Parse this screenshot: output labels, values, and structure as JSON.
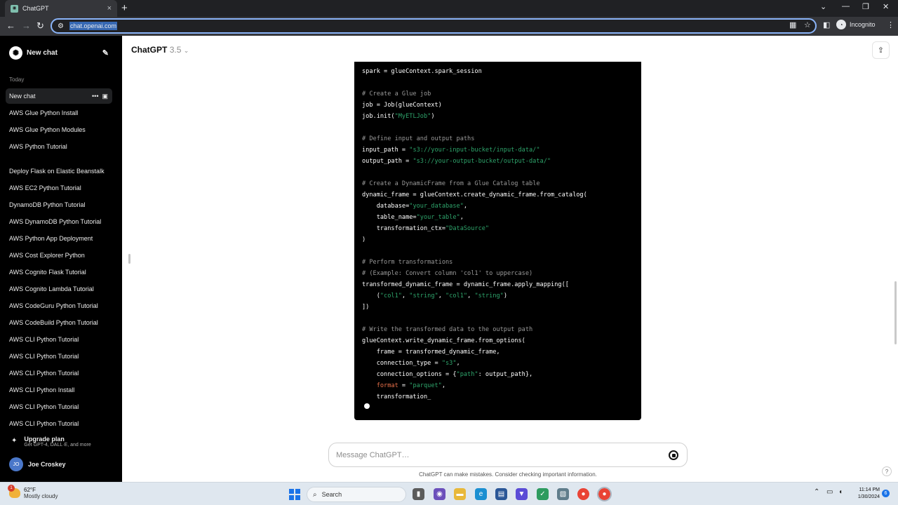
{
  "browser": {
    "tab_title": "ChatGPT",
    "tab_close": "×",
    "new_tab": "+",
    "url": "chat.openai.com",
    "incognito_label": "Incognito"
  },
  "sidebar": {
    "new_chat": "New chat",
    "section_today": "Today",
    "active_item": "New chat",
    "items": [
      "AWS Glue Python Install",
      "AWS Glue Python Modules",
      "AWS Python Tutorial",
      "Deploy Flask on Elastic Beanstalk",
      "AWS EC2 Python Tutorial",
      "DynamoDB Python Tutorial",
      "AWS DynamoDB Python Tutorial",
      "AWS Python App Deployment",
      "AWS Cost Explorer Python",
      "AWS Cognito Flask Tutorial",
      "AWS Cognito Lambda Tutorial",
      "AWS CodeGuru Python Tutorial",
      "AWS CodeBuild Python Tutorial",
      "AWS CLI Python Tutorial",
      "AWS CLI Python Tutorial",
      "AWS CLI Python Tutorial",
      "AWS CLI Python Install",
      "AWS CLI Python Tutorial",
      "AWS CLI Python Tutorial"
    ],
    "upgrade_title": "Upgrade plan",
    "upgrade_sub": "Get GPT-4, DALL·E, and more",
    "user_initials": "JO",
    "user_name": "Joe Croskey"
  },
  "main": {
    "model_name": "ChatGPT",
    "model_version": "3.5",
    "message_placeholder": "Message ChatGPT…",
    "disclaimer": "ChatGPT can make mistakes. Consider checking important information.",
    "help": "?"
  },
  "code_lines": [
    [
      [
        "spark = glueContext.spark_session",
        "t"
      ]
    ],
    [],
    [
      [
        "# Create a Glue job",
        "c"
      ]
    ],
    [
      [
        "job = Job(glueContext)",
        "t"
      ]
    ],
    [
      [
        "job.init(",
        "t"
      ],
      [
        "\"MyETLJob\"",
        "s"
      ],
      [
        ")",
        "t"
      ]
    ],
    [],
    [
      [
        "# Define input and output paths",
        "c"
      ]
    ],
    [
      [
        "input_path = ",
        "t"
      ],
      [
        "\"s3://your-input-bucket/input-data/\"",
        "s"
      ]
    ],
    [
      [
        "output_path = ",
        "t"
      ],
      [
        "\"s3://your-output-bucket/output-data/\"",
        "s"
      ]
    ],
    [],
    [
      [
        "# Create a DynamicFrame from a Glue Catalog table",
        "c"
      ]
    ],
    [
      [
        "dynamic_frame = glueContext.create_dynamic_frame.from_catalog(",
        "t"
      ]
    ],
    [
      [
        "    database=",
        "t"
      ],
      [
        "\"your_database\"",
        "s"
      ],
      [
        ",",
        "t"
      ]
    ],
    [
      [
        "    table_name=",
        "t"
      ],
      [
        "\"your_table\"",
        "s"
      ],
      [
        ",",
        "t"
      ]
    ],
    [
      [
        "    transformation_ctx=",
        "t"
      ],
      [
        "\"DataSource\"",
        "s"
      ]
    ],
    [
      [
        ")",
        "t"
      ]
    ],
    [],
    [
      [
        "# Perform transformations",
        "c"
      ]
    ],
    [
      [
        "# (Example: Convert column 'col1' to uppercase)",
        "c"
      ]
    ],
    [
      [
        "transformed_dynamic_frame = dynamic_frame.apply_mapping([",
        "t"
      ]
    ],
    [
      [
        "    (",
        "t"
      ],
      [
        "\"col1\"",
        "s"
      ],
      [
        ", ",
        "t"
      ],
      [
        "\"string\"",
        "s"
      ],
      [
        ", ",
        "t"
      ],
      [
        "\"col1\"",
        "s"
      ],
      [
        ", ",
        "t"
      ],
      [
        "\"string\"",
        "s"
      ],
      [
        ")",
        "t"
      ]
    ],
    [
      [
        "])",
        "t"
      ]
    ],
    [],
    [
      [
        "# Write the transformed data to the output path",
        "c"
      ]
    ],
    [
      [
        "glueContext.write_dynamic_frame.from_options(",
        "t"
      ]
    ],
    [
      [
        "    frame = transformed_dynamic_frame,",
        "t"
      ]
    ],
    [
      [
        "    connection_type = ",
        "t"
      ],
      [
        "\"s3\"",
        "s"
      ],
      [
        ",",
        "t"
      ]
    ],
    [
      [
        "    connection_options = {",
        "t"
      ],
      [
        "\"path\"",
        "s"
      ],
      [
        ": output_path},",
        "t"
      ]
    ],
    [
      [
        "    ",
        "t"
      ],
      [
        "format",
        "k"
      ],
      [
        " = ",
        "t"
      ],
      [
        "\"parquet\"",
        "s"
      ],
      [
        ",",
        "t"
      ]
    ],
    [
      [
        "    transformation_",
        "t"
      ]
    ]
  ],
  "taskbar": {
    "temp": "62°F",
    "weather": "Mostly cloudy",
    "weather_badge": "1",
    "search": "Search",
    "time": "11:14 PM",
    "date": "1/30/2024",
    "notifications": "6"
  }
}
